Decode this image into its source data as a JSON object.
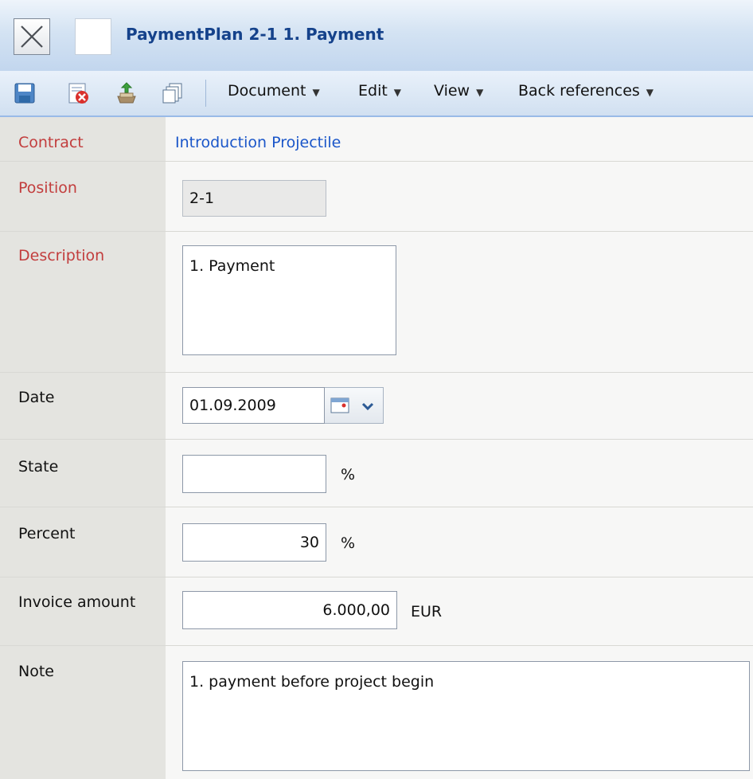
{
  "window": {
    "title": "PaymentPlan 2-1 1. Payment"
  },
  "toolbar": {
    "icons": [
      "save-icon",
      "discard-icon",
      "export-icon",
      "copy-icon"
    ],
    "menus": [
      {
        "label": "Document",
        "arrow": "▼"
      },
      {
        "label": "Edit",
        "arrow": "▼"
      },
      {
        "label": "View",
        "arrow": "▼"
      },
      {
        "label": "Back references",
        "arrow": "▼"
      }
    ]
  },
  "form": {
    "contract": {
      "label": "Contract",
      "value": "Introduction Projectile"
    },
    "position": {
      "label": "Position",
      "value": "2-1"
    },
    "description": {
      "label": "Description",
      "value": "1. Payment"
    },
    "date": {
      "label": "Date",
      "value": "01.09.2009"
    },
    "state": {
      "label": "State",
      "value": "",
      "unit": "%"
    },
    "percent": {
      "label": "Percent",
      "value": "30",
      "unit": "%"
    },
    "invoice_amount": {
      "label": "Invoice amount",
      "value": "6.000,00",
      "unit": "EUR"
    },
    "note": {
      "label": "Note",
      "value": "1. payment before project begin"
    }
  },
  "colors": {
    "required_label": "#c23d3d",
    "link": "#1a56c9",
    "title_text": "#15428b",
    "toolbar_border": "#99bbe8"
  }
}
